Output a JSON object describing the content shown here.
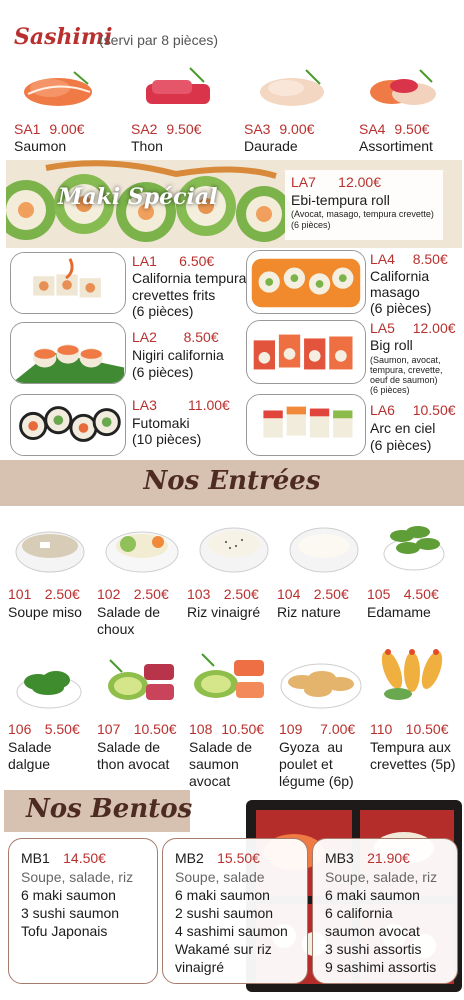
{
  "sashimi": {
    "title": "Sashimi",
    "subtitle": "(servi par 8 pièces)",
    "items": [
      {
        "code": "SA1",
        "price": "9.00€",
        "name": "Saumon"
      },
      {
        "code": "SA2",
        "price": "9.50€",
        "name": "Thon"
      },
      {
        "code": "SA3",
        "price": "9.00€",
        "name": "Daurade"
      },
      {
        "code": "SA4",
        "price": "9.50€",
        "name": "Assortiment"
      }
    ]
  },
  "maki": {
    "title": "Maki Spécial",
    "la7": {
      "code": "LA7",
      "price": "12.00€",
      "name": "Ebi-tempura roll",
      "desc": "(Avocat, masago, tempura crevette)",
      "qty": "(6 pièces)"
    },
    "items": [
      {
        "code": "LA1",
        "price": "6.50€",
        "line1": "California tempura",
        "line2": "crevettes frits",
        "qty": "(6 pièces)"
      },
      {
        "code": "LA4",
        "price": "8.50€",
        "line1": "California",
        "line2": "masago",
        "qty": "(6 pièces)"
      },
      {
        "code": "LA2",
        "price": "8.50€",
        "line1": "Nigiri california",
        "qty": "(6 pièces)"
      },
      {
        "code": "LA5",
        "price": "12.00€",
        "line1": "Big roll",
        "desc": [
          "(Saumon, avocat,",
          "tempura, crevette,",
          "oeuf de saumon)",
          "(6 pièces)"
        ]
      },
      {
        "code": "LA3",
        "price": "11.00€",
        "line1": "Futomaki",
        "qty": "(10 pièces)"
      },
      {
        "code": "LA6",
        "price": "10.50€",
        "line1": "Arc en ciel",
        "qty": "(6 pièces)"
      }
    ]
  },
  "entrees": {
    "title": "Nos Entrées",
    "row1": [
      {
        "code": "101",
        "price": "2.50€",
        "name": [
          "Soupe miso"
        ]
      },
      {
        "code": "102",
        "price": "2.50€",
        "name": [
          "Salade de",
          "choux"
        ]
      },
      {
        "code": "103",
        "price": "2.50€",
        "name": [
          "Riz vinaigré"
        ]
      },
      {
        "code": "104",
        "price": "2.50€",
        "name": [
          "Riz nature"
        ]
      },
      {
        "code": "105",
        "price": "4.50€",
        "name": [
          "Edamame"
        ]
      }
    ],
    "row2": [
      {
        "code": "106",
        "price": "5.50€",
        "name": [
          "Salade",
          "dalgue"
        ]
      },
      {
        "code": "107",
        "price": "10.50€",
        "name": [
          "Salade de",
          "thon avocat"
        ]
      },
      {
        "code": "108",
        "price": "10.50€",
        "name": [
          "Salade de",
          "saumon",
          "avocat"
        ]
      },
      {
        "code": "109",
        "price": "7.00€",
        "name": [
          "Gyoza  au",
          "poulet et",
          "légume (6p)"
        ]
      },
      {
        "code": "110",
        "price": "10.50€",
        "name": [
          "Tempura aux",
          "crevettes (5p)"
        ]
      }
    ]
  },
  "bentos": {
    "title": "Nos Bentos",
    "items": [
      {
        "code": "MB1",
        "price": "14.50€",
        "sub": "Soupe, salade, riz",
        "lines": [
          "6 maki saumon",
          "3 sushi saumon",
          "Tofu Japonais"
        ]
      },
      {
        "code": "MB2",
        "price": "15.50€",
        "sub": "Soupe, salade",
        "lines": [
          "6 maki saumon",
          "2 sushi saumon",
          "4 sashimi saumon",
          "Wakamé sur riz",
          "vinaigré"
        ]
      },
      {
        "code": "MB3",
        "price": "21.90€",
        "sub": "Soupe, salade, riz",
        "lines": [
          "6 maki saumon",
          "6 california",
          "saumon avocat",
          "3 sushi assortis",
          "9 sashimi assortis"
        ]
      }
    ]
  }
}
